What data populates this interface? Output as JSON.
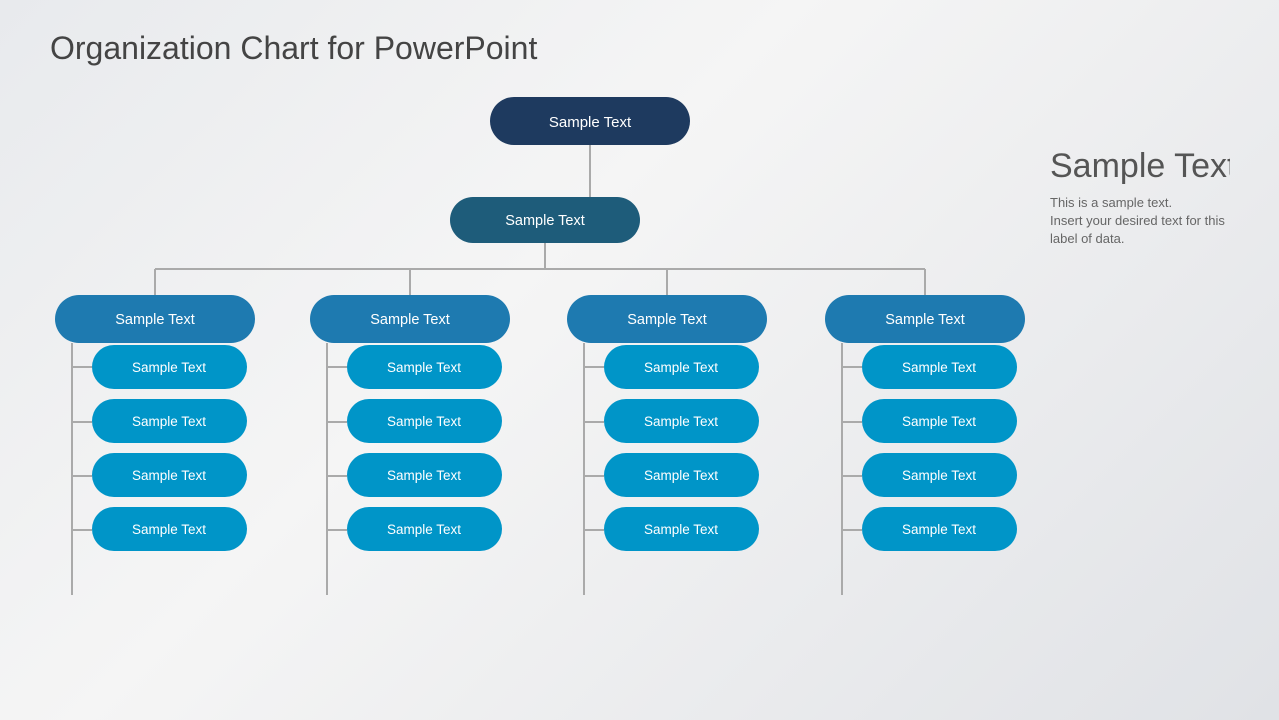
{
  "page": {
    "title": "Organization Chart for PowerPoint",
    "background": "linear-gradient(135deg, #e8eaed, #f5f5f5, #e0e2e6)"
  },
  "chart": {
    "root": "Sample Text",
    "level1": "Sample Text",
    "sidebar_heading": "Sample Text",
    "sidebar_desc1": "This is a sample text.",
    "sidebar_desc2": "Insert your desired text for this",
    "sidebar_desc3": "label of data.",
    "columns": [
      {
        "header": "Sample Text",
        "items": [
          "Sample Text",
          "Sample Text",
          "Sample Text",
          "Sample Text"
        ]
      },
      {
        "header": "Sample Text",
        "items": [
          "Sample Text",
          "Sample Text",
          "Sample Text",
          "Sample Text"
        ]
      },
      {
        "header": "Sample Text",
        "items": [
          "Sample Text",
          "Sample Text",
          "Sample Text",
          "Sample Text"
        ]
      },
      {
        "header": "Sample Text",
        "items": [
          "Sample Text",
          "Sample Text",
          "Sample Text",
          "Sample Text"
        ]
      }
    ]
  },
  "colors": {
    "root_bg": "#1e3a5f",
    "level1_bg": "#1e5c7a",
    "header_bg": "#1e7ab0",
    "sub_bg": "#0095c8",
    "line": "#aaaaaa",
    "text_title": "#444444",
    "text_sidebar_head": "#555555",
    "text_sidebar_body": "#666666"
  }
}
